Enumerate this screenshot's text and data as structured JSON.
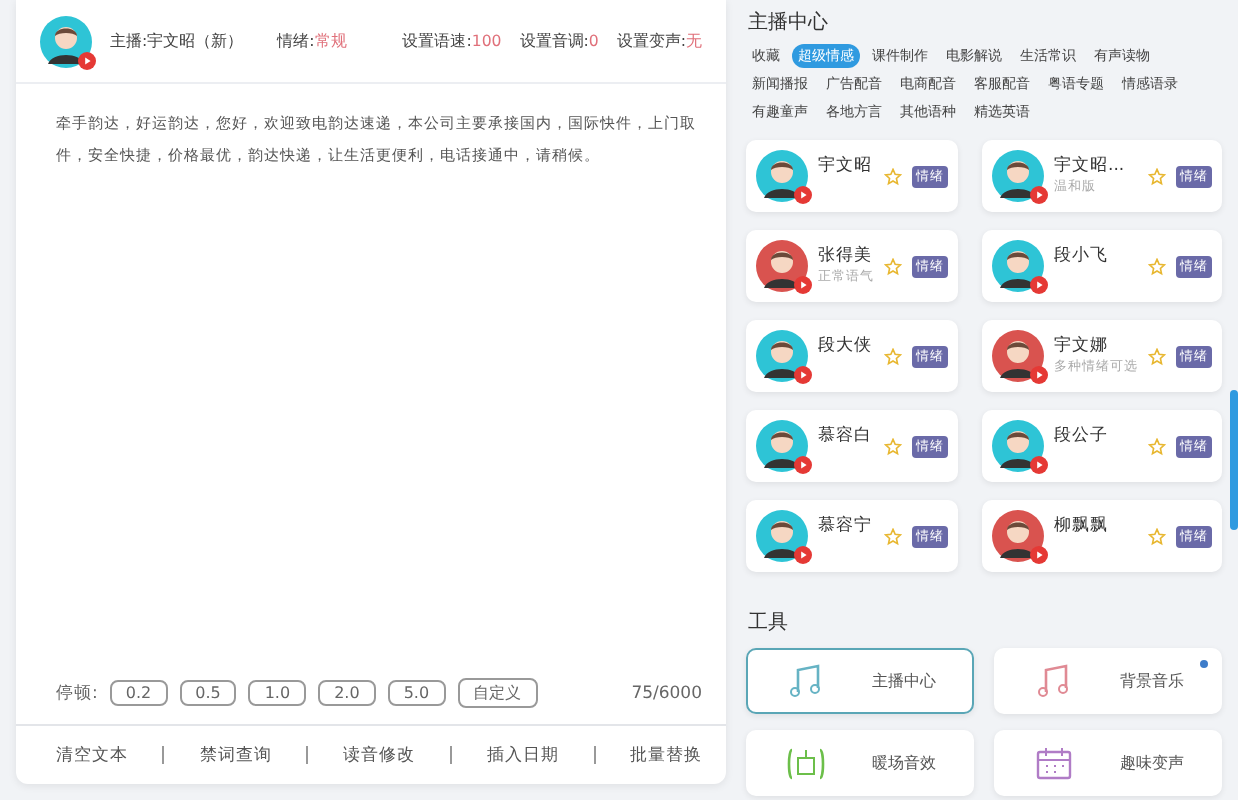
{
  "editor": {
    "anchor_label": "主播:宇文昭（新）",
    "emotion_label": "情绪:",
    "emotion_value": "常规",
    "settings": [
      {
        "label": "设置语速:",
        "value": "100"
      },
      {
        "label": "设置音调:",
        "value": "0"
      },
      {
        "label": "设置变声:",
        "value": "无"
      }
    ],
    "text": "牵手韵达，好运韵达，您好，欢迎致电韵达速递，本公司主要承接国内，国际快件，上门取件，安全快捷，价格最优，韵达快递，让生活更便利，电话接通中，请稍候。",
    "pause_label": "停顿:",
    "pauses": [
      "0.2",
      "0.5",
      "1.0",
      "2.0",
      "5.0",
      "自定义"
    ],
    "counter": "75/6000",
    "actions": [
      "清空文本",
      "禁词查询",
      "读音修改",
      "插入日期",
      "批量替换"
    ]
  },
  "anchor_center": {
    "title": "主播中心",
    "categories": [
      {
        "label": "收藏",
        "selected": false
      },
      {
        "label": "超级情感",
        "selected": true
      },
      {
        "label": "课件制作",
        "selected": false
      },
      {
        "label": "电影解说",
        "selected": false
      },
      {
        "label": "生活常识",
        "selected": false
      },
      {
        "label": "有声读物",
        "selected": false
      },
      {
        "label": "新闻播报",
        "selected": false
      },
      {
        "label": "广告配音",
        "selected": false
      },
      {
        "label": "电商配音",
        "selected": false
      },
      {
        "label": "客服配音",
        "selected": false
      },
      {
        "label": "粤语专题",
        "selected": false
      },
      {
        "label": "情感语录",
        "selected": false
      },
      {
        "label": "有趣童声",
        "selected": false
      },
      {
        "label": "各地方言",
        "selected": false
      },
      {
        "label": "其他语种",
        "selected": false
      },
      {
        "label": "精选英语",
        "selected": false
      }
    ],
    "anchors": [
      {
        "name": "宇文昭",
        "color": "#2ec4d6",
        "badge": "情绪"
      },
      {
        "name": "宇文昭...",
        "subtitle": "温和版",
        "color": "#2ec4d6",
        "badge": "情绪"
      },
      {
        "name": "张得美",
        "subtitle": "正常语气",
        "color": "#d9534f",
        "badge": "情绪"
      },
      {
        "name": "段小飞",
        "color": "#2ec4d6",
        "badge": "情绪"
      },
      {
        "name": "段大侠",
        "color": "#2ec4d6",
        "badge": "情绪"
      },
      {
        "name": "宇文娜",
        "subtitle": "多种情绪可选",
        "color": "#d9534f",
        "badge": "情绪"
      },
      {
        "name": "慕容白",
        "color": "#2ec4d6",
        "badge": "情绪"
      },
      {
        "name": "段公子",
        "color": "#2ec4d6",
        "badge": "情绪"
      },
      {
        "name": "慕容宁",
        "color": "#2ec4d6",
        "badge": "情绪"
      },
      {
        "name": "柳飘飘",
        "color": "#d9534f",
        "badge": "情绪"
      }
    ]
  },
  "tools": {
    "title": "工具",
    "items": [
      {
        "kind": "note",
        "label": "主播中心",
        "selected": true,
        "dot": false
      },
      {
        "kind": "music",
        "label": "背景音乐",
        "selected": false,
        "dot": true
      },
      {
        "kind": "sound",
        "label": "暖场音效",
        "selected": false,
        "dot": false
      },
      {
        "kind": "calendar",
        "label": "趣味变声",
        "selected": false,
        "dot": false
      }
    ]
  }
}
